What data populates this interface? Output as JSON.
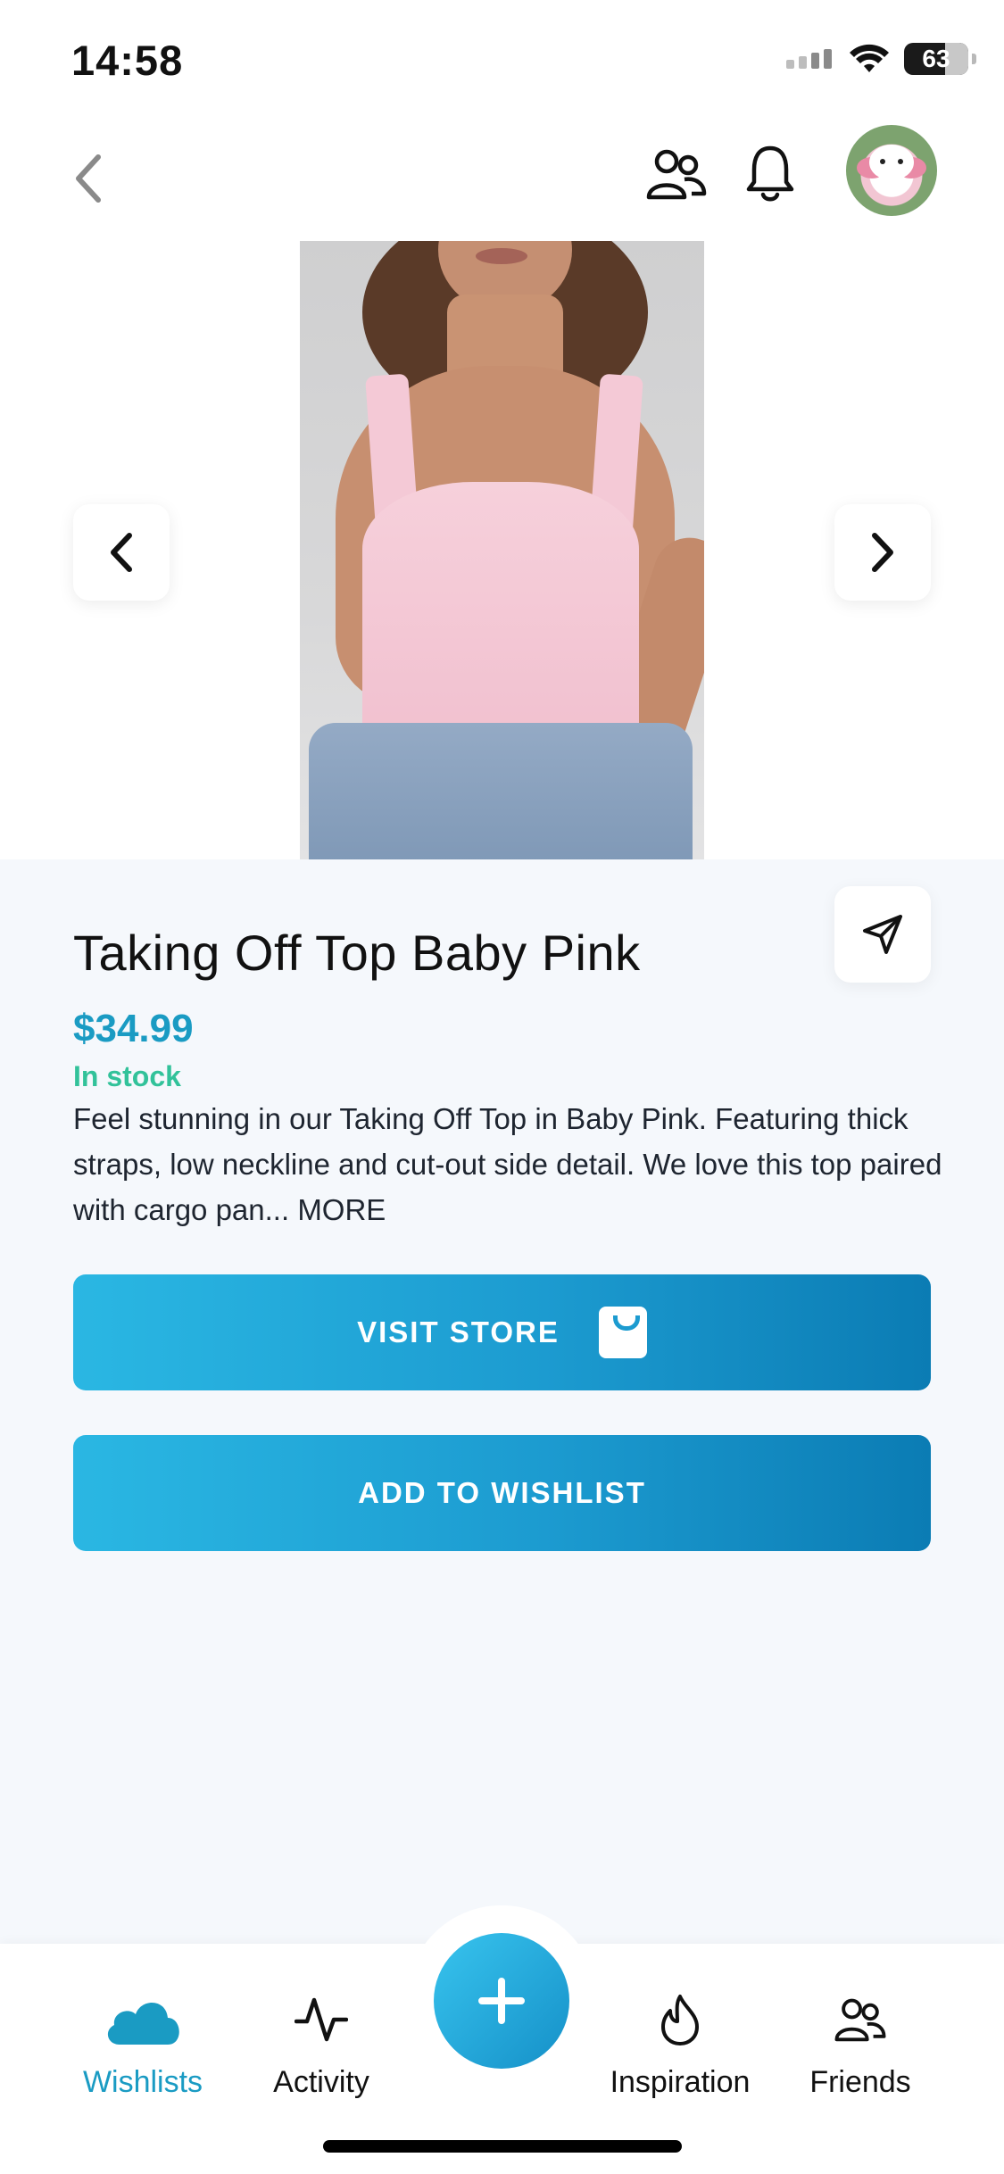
{
  "status_bar": {
    "time": "14:58",
    "battery": "63"
  },
  "product": {
    "title": "Taking Off Top Baby Pink",
    "price": "$34.99",
    "stock": "In stock",
    "description": "Feel stunning in our Taking Off Top in Baby Pink. Featuring thick straps, low neckline and cut-out side detail. We love this top paired with cargo pan...",
    "more_label": "MORE"
  },
  "buttons": {
    "visit_store": "VISIT STORE",
    "add_to_wishlist": "ADD TO WISHLIST"
  },
  "nav": {
    "items": [
      {
        "label": "Wishlists",
        "icon": "cloud-icon",
        "active": true
      },
      {
        "label": "Activity",
        "icon": "activity-icon",
        "active": false
      },
      {
        "label": "Inspiration",
        "icon": "flame-icon",
        "active": false
      },
      {
        "label": "Friends",
        "icon": "friends-icon",
        "active": false
      }
    ],
    "add_icon": "plus-icon"
  },
  "colors": {
    "accent": "#1a9bc3",
    "stock": "#32c29a",
    "button_start": "#2ab7e3",
    "button_end": "#0b7cb4",
    "details_bg": "#f5f8fc"
  }
}
